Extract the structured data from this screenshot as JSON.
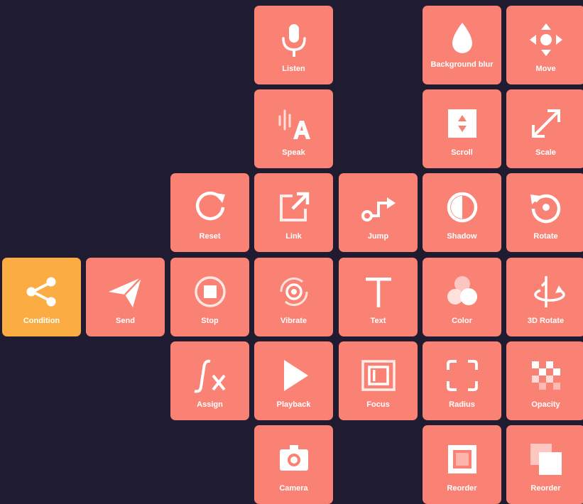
{
  "colors": {
    "background": "#1f1c31",
    "tile": "#fa8275",
    "accent_tile": "#fbad43",
    "icon": "#ffffff"
  },
  "tiles": [
    {
      "label": "Listen",
      "icon": "microphone-icon"
    },
    {
      "label": "Background blur",
      "icon": "droplet-icon"
    },
    {
      "label": "Move",
      "icon": "move-arrows-icon"
    },
    {
      "label": "Speak",
      "icon": "speak-icon"
    },
    {
      "label": "Scroll",
      "icon": "scroll-icon"
    },
    {
      "label": "Scale",
      "icon": "scale-icon"
    },
    {
      "label": "Reset",
      "icon": "reset-icon"
    },
    {
      "label": "Link",
      "icon": "external-link-icon"
    },
    {
      "label": "Jump",
      "icon": "jump-icon"
    },
    {
      "label": "Shadow",
      "icon": "shadow-icon"
    },
    {
      "label": "Rotate",
      "icon": "rotate-icon"
    },
    {
      "label": "Condition",
      "icon": "share-icon"
    },
    {
      "label": "Send",
      "icon": "paper-plane-icon"
    },
    {
      "label": "Stop",
      "icon": "stop-icon"
    },
    {
      "label": "Vibrate",
      "icon": "vibrate-icon"
    },
    {
      "label": "Text",
      "icon": "text-icon"
    },
    {
      "label": "Color",
      "icon": "color-icon"
    },
    {
      "label": "3D Rotate",
      "icon": "rotate-3d-icon"
    },
    {
      "label": "Assign",
      "icon": "function-icon"
    },
    {
      "label": "Playback",
      "icon": "play-icon"
    },
    {
      "label": "Focus",
      "icon": "focus-icon"
    },
    {
      "label": "Radius",
      "icon": "radius-icon"
    },
    {
      "label": "Opacity",
      "icon": "opacity-icon"
    },
    {
      "label": "Camera",
      "icon": "camera-icon"
    },
    {
      "label": "Reorder",
      "icon": "reorder-icon"
    },
    {
      "label": "Reorder",
      "icon": "layers-icon"
    }
  ]
}
